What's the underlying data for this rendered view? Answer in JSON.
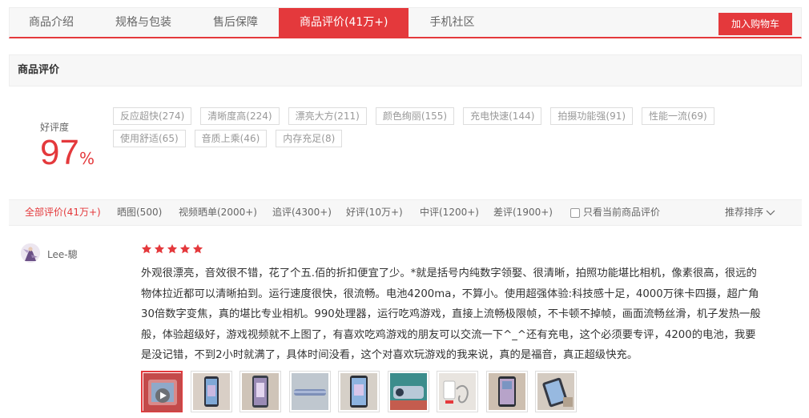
{
  "tabs": [
    {
      "label": "商品介绍"
    },
    {
      "label": "规格与包装"
    },
    {
      "label": "售后保障"
    },
    {
      "label": "商品评价(41万+)"
    },
    {
      "label": "手机社区"
    }
  ],
  "add_cart_label": "加入购物车",
  "section_title": "商品评价",
  "rate": {
    "label": "好评度",
    "value": "97",
    "unit": "%"
  },
  "tags": [
    "反应超快(274)",
    "清晰度高(224)",
    "漂亮大方(211)",
    "颜色绚丽(155)",
    "充电快速(144)",
    "拍摄功能强(91)",
    "性能一流(69)",
    "使用舒适(65)",
    "音质上乘(46)",
    "内存充足(8)"
  ],
  "filters": [
    "全部评价(41万+)",
    "晒图(500)",
    "视频晒单(2000+)",
    "追评(4300+)",
    "好评(10万+)",
    "中评(1200+)",
    "差评(1900+)"
  ],
  "only_current_label": "只看当前商品评价",
  "sort_label": "推荐排序",
  "review": {
    "username": "Lee-驄",
    "stars": 5,
    "text_lines": [
      "外观很漂亮，音效很不错，花了个五.佰的折扣便宜了少。*就是括号内纯数字领娶、很清晰，拍照功能堪比相机，像素很高，很远的",
      "物体拉近都可以清晰拍到。运行速度很快，很流畅。电池4200ma，不算小。使用超强体验:科技感十足，4000万徕卡四摄，超广角",
      "30倍数字变焦，真的堪比专业相机。990处理器，运行吃鸡游戏，直接上流畅极限帧，不卡顿不掉帧，画面流畅丝滑，机子发热一般",
      "般，体验超级好，游戏视频就不上图了，有喜欢吃鸡游戏的朋友可以交流一下^_^还有充电，这个必须要专评，4200的电池，我要",
      "是没记错，不到2小时就满了，具体时间没看，这个对喜欢玩游戏的我来说，真的是福音，真正超级快充。"
    ]
  },
  "colors": {
    "accent": "#e4393c",
    "muted": "#999999",
    "bar_bg": "#f7f7f7"
  },
  "icons": {
    "star": "star-icon",
    "play": "play-icon",
    "sort": "chevron-down-icon"
  }
}
